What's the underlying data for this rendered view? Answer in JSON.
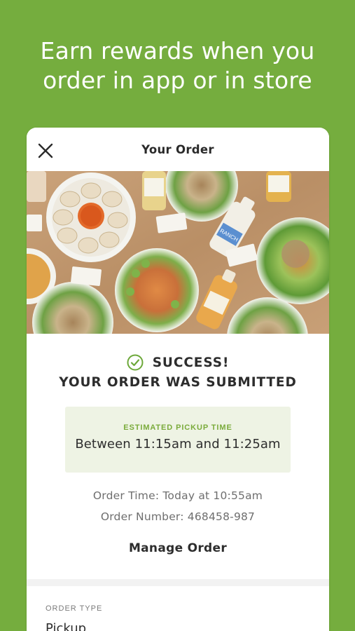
{
  "headline": {
    "line1": "Earn rewards when you",
    "line2": "order in app or in store"
  },
  "header": {
    "title": "Your Order",
    "close_icon": "close-icon"
  },
  "hero": {
    "image": "salads-bowls-and-dressings-photo",
    "label_text": "RANCH"
  },
  "status": {
    "icon": "check-circle-icon",
    "line1": "SUCCESS!",
    "line2": "YOUR ORDER WAS SUBMITTED"
  },
  "pickup": {
    "label": "ESTIMATED PICKUP TIME",
    "time": "Between 11:15am and 11:25am"
  },
  "order": {
    "time": "Order Time: Today at 10:55am",
    "number": "Order Number: 468458-987"
  },
  "actions": {
    "manage_label": "Manage Order"
  },
  "details": {
    "order_type_label": "ORDER TYPE",
    "order_type_value": "Pickup"
  },
  "colors": {
    "brand_green": "#75ad3e",
    "accent_green": "#7aab3b",
    "pickup_bg": "#eef3e4"
  }
}
